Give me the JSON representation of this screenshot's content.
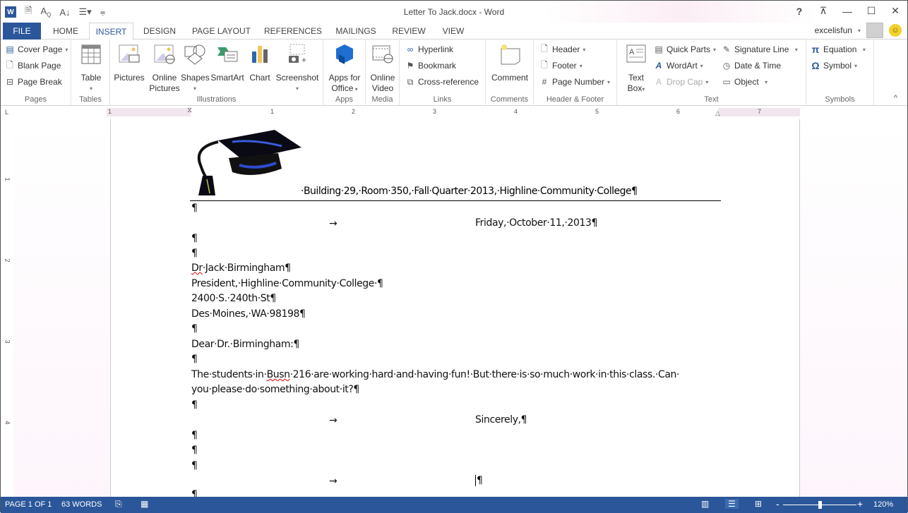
{
  "titlebar": {
    "title": "Letter To Jack.docx - Word",
    "qat_icons": [
      "word-logo",
      "save-icon",
      "spelling-icon",
      "sort-icon",
      "numbering-icon",
      "customize-qat-icon"
    ],
    "controls": {
      "help": "?",
      "ribbon_display": "⊼",
      "minimize": "—",
      "maximize": "☐",
      "close": "✕"
    }
  },
  "tabs": [
    {
      "label": "FILE"
    },
    {
      "label": "HOME"
    },
    {
      "label": "INSERT",
      "active": true
    },
    {
      "label": "DESIGN"
    },
    {
      "label": "PAGE LAYOUT"
    },
    {
      "label": "REFERENCES"
    },
    {
      "label": "MAILINGS"
    },
    {
      "label": "REVIEW"
    },
    {
      "label": "VIEW"
    }
  ],
  "account": {
    "user": "excelisfun",
    "caret": "▾",
    "smiley": "☺"
  },
  "ribbon": {
    "pages": {
      "label": "Pages",
      "cover_page": "Cover Page",
      "blank_page": "Blank Page",
      "page_break": "Page Break"
    },
    "tables": {
      "label": "Tables",
      "table": "Table"
    },
    "illustrations": {
      "label": "Illustrations",
      "pictures": "Pictures",
      "online_pictures_1": "Online",
      "online_pictures_2": "Pictures",
      "shapes": "Shapes",
      "smartart": "SmartArt",
      "chart": "Chart",
      "screenshot": "Screenshot"
    },
    "apps": {
      "label": "Apps",
      "apps_1": "Apps for",
      "apps_2": "Office"
    },
    "media": {
      "label": "Media",
      "video_1": "Online",
      "video_2": "Video"
    },
    "links": {
      "label": "Links",
      "hyperlink": "Hyperlink",
      "bookmark": "Bookmark",
      "cross_reference": "Cross-reference"
    },
    "comments": {
      "label": "Comments",
      "comment": "Comment"
    },
    "header_footer": {
      "label": "Header & Footer",
      "header": "Header",
      "footer": "Footer",
      "page_number": "Page Number"
    },
    "text": {
      "label": "Text",
      "text_box_1": "Text",
      "text_box_2": "Box",
      "quick_parts": "Quick Parts",
      "wordart": "WordArt",
      "drop_cap": "Drop Cap",
      "signature_line": "Signature Line",
      "date_time": "Date & Time",
      "object": "Object"
    },
    "symbols": {
      "label": "Symbols",
      "equation": "Equation",
      "symbol": "Symbol"
    },
    "collapse": "^"
  },
  "ruler": {
    "h_numbers": [
      "1",
      "1",
      "2",
      "3",
      "4",
      "5",
      "6",
      "7"
    ],
    "v_numbers": [
      "1",
      "2",
      "3",
      "4"
    ],
    "tab_selector": "L"
  },
  "document": {
    "header_line": "·Building·29,·Room·350,·Fall·Quarter·2013,·Highline·Community·College¶",
    "pilcrow": "¶",
    "tab_arrow": "→",
    "date": "Friday,·October·11,·2013¶",
    "addr_name_pre": "Dr",
    "addr_name_post": "·Jack·Birmingham¶",
    "addr_title": "President,·Highline·Community·College·¶",
    "addr_street": "2400·S.·240th·St¶",
    "addr_city": "Des·Moines,·WA·98198¶",
    "salutation": "Dear·Dr.·Birmingham:¶",
    "body_pre": "The·students·in·",
    "body_busn": "Busn",
    "body_post": "·216·are·working·hard·and·having·fun!·But·there·is·so·much·work·in·this·class.·Can·",
    "body_line2": "you·please·do·something·about·it?¶",
    "closing": "Sincerely,¶"
  },
  "status": {
    "page": "PAGE 1 OF 1",
    "words": "63 WORDS",
    "zoom": "120%",
    "zoom_minus": "-",
    "zoom_plus": "+",
    "zoom_level_percent": 120
  }
}
